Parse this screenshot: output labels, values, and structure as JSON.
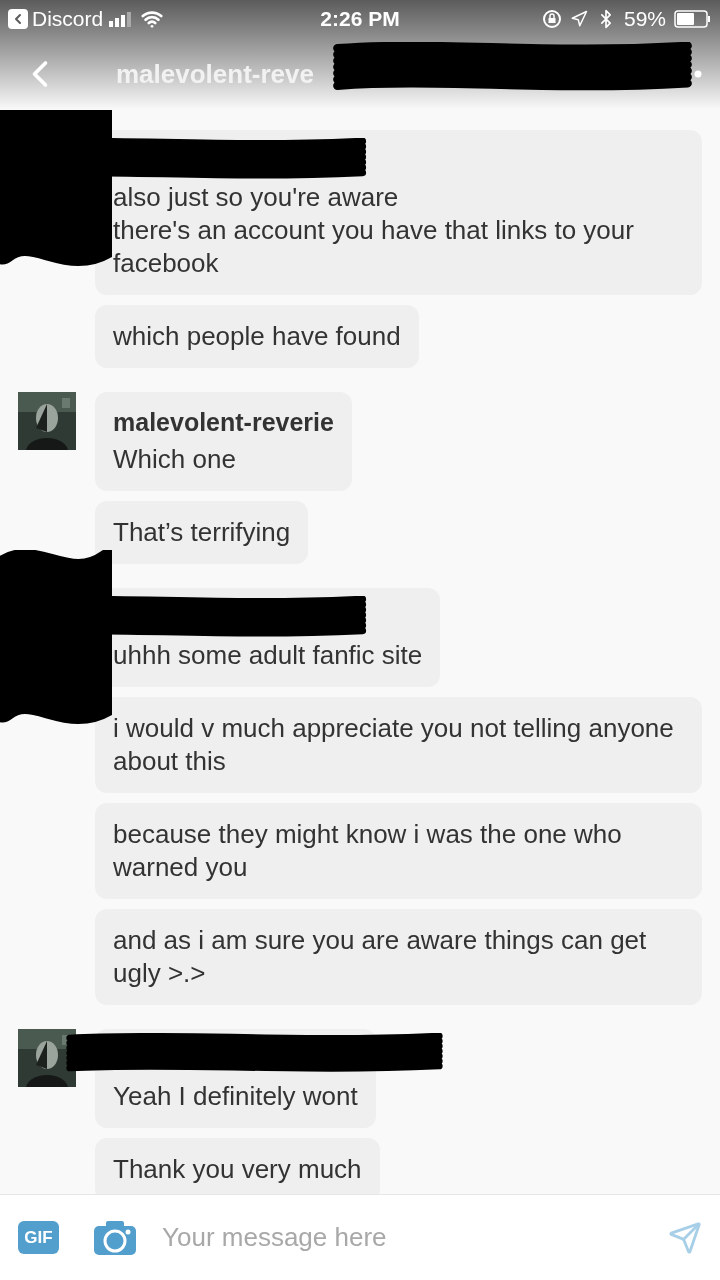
{
  "status_bar": {
    "back_app": "Discord",
    "time": "2:26 PM",
    "battery": "59%"
  },
  "header": {
    "title": "malevolent-reve",
    "title_redacted": true
  },
  "groups": [
    {
      "avatar_redacted": true,
      "name_redacted": true,
      "messages": [
        {
          "text": "also just so you're aware\nthere's an account you have that links to your facebook"
        },
        {
          "text": "which people have found"
        }
      ]
    },
    {
      "avatar_redacted": false,
      "name": "malevolent-reverie",
      "name_redacted": false,
      "messages": [
        {
          "text": "Which one"
        },
        {
          "text": "That’s terrifying"
        }
      ]
    },
    {
      "avatar_redacted": true,
      "name_redacted": true,
      "messages": [
        {
          "text": "uhhh some adult fanfic site"
        },
        {
          "text": "i would v much appreciate you not telling anyone about this"
        },
        {
          "text": "because they might know i was the one who warned you"
        },
        {
          "text": "and as i am sure you are aware things can get ugly >.>"
        }
      ]
    },
    {
      "avatar_redacted": false,
      "name_redacted": true,
      "messages": [
        {
          "text": "Yeah I definitely wont"
        },
        {
          "text": "Thank you very much"
        }
      ]
    }
  ],
  "composer": {
    "gif": "GIF",
    "placeholder": "Your message here"
  }
}
